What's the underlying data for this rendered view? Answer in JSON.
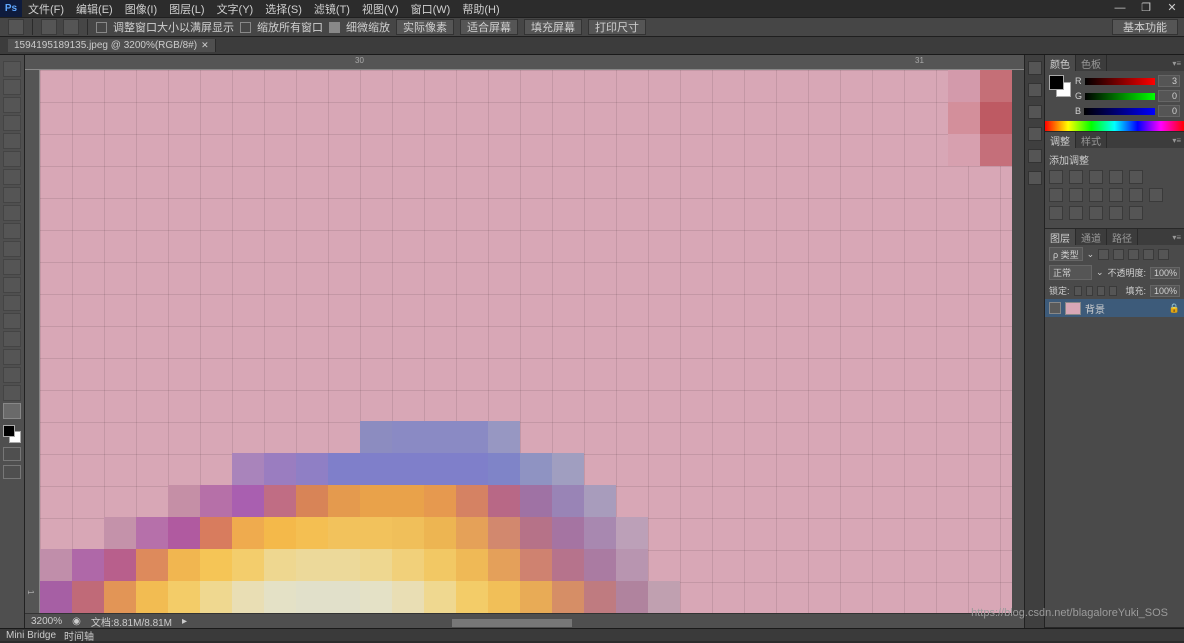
{
  "app": {
    "logo": "Ps"
  },
  "menu": {
    "file": "文件(F)",
    "edit": "编辑(E)",
    "image": "图像(I)",
    "layer": "图层(L)",
    "type": "文字(Y)",
    "select": "选择(S)",
    "filter": "滤镜(T)",
    "view": "视图(V)",
    "window": "窗口(W)",
    "help": "帮助(H)"
  },
  "options": {
    "resize_fill": "调整窗口大小以满屏显示",
    "zoom_all": "缩放所有窗口",
    "scrubby": "细微缩放",
    "actual": "实际像素",
    "fit": "适合屏幕",
    "fill": "填充屏幕",
    "print_size": "打印尺寸",
    "essentials": "基本功能"
  },
  "document": {
    "tab_title": "1594195189135.jpeg @ 3200%(RGB/8#)"
  },
  "ruler": {
    "h1": "30",
    "h2": "31",
    "v1": "1"
  },
  "status": {
    "zoom": "3200%",
    "doc": "文档:8.81M/8.81M"
  },
  "bottom": {
    "mini_bridge": "Mini Bridge",
    "timeline": "时间轴"
  },
  "panels": {
    "color": {
      "tab": "颜色",
      "swatches_tab": "色板",
      "r": "R",
      "g": "G",
      "b": "B",
      "r_val": "3",
      "g_val": "0",
      "b_val": "0"
    },
    "adjust": {
      "tab": "调整",
      "styles_tab": "样式",
      "add_label": "添加调整"
    },
    "layers": {
      "tab": "图层",
      "channels_tab": "通道",
      "paths_tab": "路径",
      "kind_label": "ρ 类型",
      "blend_mode": "正常",
      "opacity_label": "不透明度:",
      "opacity_val": "100%",
      "lock_label": "锁定:",
      "fill_label": "填充:",
      "fill_val": "100%",
      "layer_name": "背景"
    }
  },
  "watermark": "https://blog.csdn.net/blagaloreYuki_SOS"
}
